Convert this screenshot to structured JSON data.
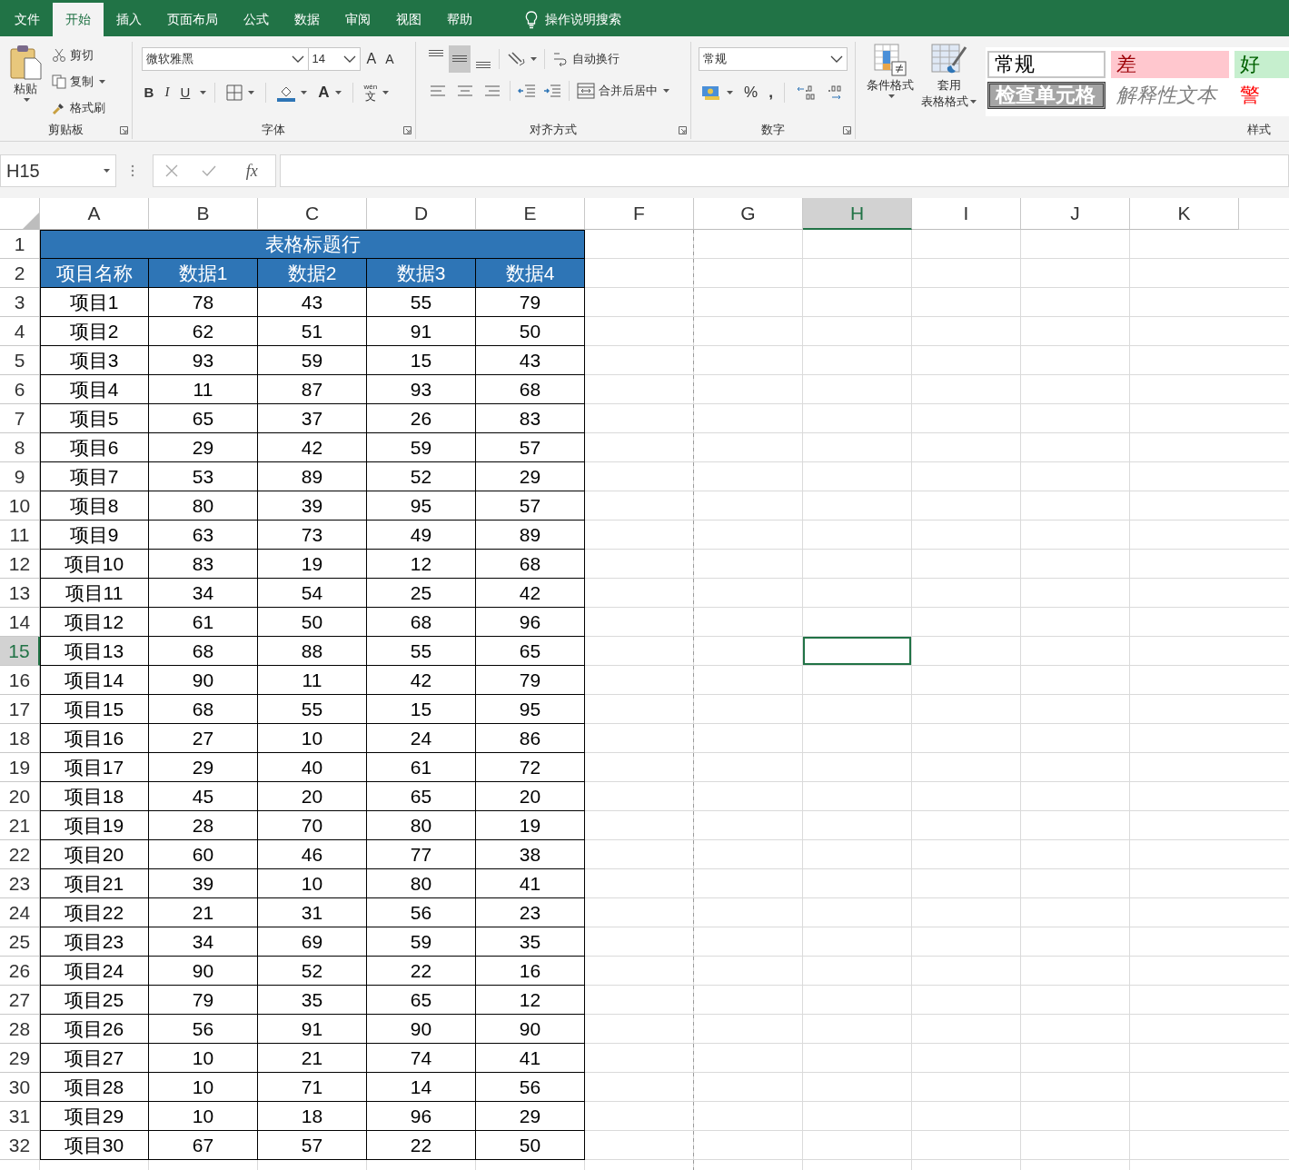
{
  "tabs": [
    {
      "label": "文件",
      "selected": false
    },
    {
      "label": "开始",
      "selected": true
    },
    {
      "label": "插入",
      "selected": false
    },
    {
      "label": "页面布局",
      "selected": false
    },
    {
      "label": "公式",
      "selected": false
    },
    {
      "label": "数据",
      "selected": false
    },
    {
      "label": "审阅",
      "selected": false
    },
    {
      "label": "视图",
      "selected": false
    },
    {
      "label": "帮助",
      "selected": false
    }
  ],
  "tell_me": {
    "placeholder": "操作说明搜索"
  },
  "ribbon": {
    "clipboard": {
      "paste": "粘贴",
      "cut": "剪切",
      "copy": "复制",
      "format_painter": "格式刷",
      "label": "剪贴板"
    },
    "font": {
      "name": "微软雅黑",
      "size": "14",
      "grow": "A",
      "shrink": "A",
      "bold": "B",
      "italic": "I",
      "underline": "U",
      "font_color": "A",
      "phonetic_top": "wén",
      "phonetic": "文",
      "label": "字体"
    },
    "alignment": {
      "vertical_align": [
        {
          "selected": false
        },
        {
          "selected": true
        },
        {
          "selected": false
        }
      ],
      "wrap_text": "自动换行",
      "merge_center": "合并后居中",
      "label": "对齐方式"
    },
    "number": {
      "format": "常规",
      "percent": "%",
      "comma": ",",
      "label": "数字"
    },
    "styles": {
      "conditional": "条件格式",
      "table_format_line1": "套用",
      "table_format_line2": "表格格式",
      "label": "样式",
      "cell_styles": [
        {
          "label": "常规",
          "kind": "normal"
        },
        {
          "label": "差",
          "kind": "bad"
        },
        {
          "label": "好",
          "kind": "good"
        },
        {
          "label": "检查单元格",
          "kind": "check"
        },
        {
          "label": "解释性文本",
          "kind": "explanatory"
        },
        {
          "label": "警",
          "kind": "warning"
        }
      ]
    }
  },
  "formula_bar": {
    "name_box": "H15",
    "fx": "fx"
  },
  "sheet": {
    "columns": [
      {
        "label": "A",
        "selected": false
      },
      {
        "label": "B",
        "selected": false
      },
      {
        "label": "C",
        "selected": false
      },
      {
        "label": "D",
        "selected": false
      },
      {
        "label": "E",
        "selected": false
      },
      {
        "label": "F",
        "selected": false
      },
      {
        "label": "G",
        "selected": false
      },
      {
        "label": "H",
        "selected": true
      },
      {
        "label": "I",
        "selected": false
      },
      {
        "label": "J",
        "selected": false
      },
      {
        "label": "K",
        "selected": false
      }
    ],
    "rows": [
      {
        "number": "1",
        "kind": "title",
        "selected": false,
        "cells": [
          "",
          "",
          "表格标题行",
          "",
          ""
        ]
      },
      {
        "number": "2",
        "kind": "header",
        "selected": false,
        "cells": [
          "项目名称",
          "数据1",
          "数据2",
          "数据3",
          "数据4"
        ]
      },
      {
        "number": "3",
        "kind": "data",
        "selected": false,
        "cells": [
          "项目1",
          "78",
          "43",
          "55",
          "79"
        ]
      },
      {
        "number": "4",
        "kind": "data",
        "selected": false,
        "cells": [
          "项目2",
          "62",
          "51",
          "91",
          "50"
        ]
      },
      {
        "number": "5",
        "kind": "data",
        "selected": false,
        "cells": [
          "项目3",
          "93",
          "59",
          "15",
          "43"
        ]
      },
      {
        "number": "6",
        "kind": "data",
        "selected": false,
        "cells": [
          "项目4",
          "11",
          "87",
          "93",
          "68"
        ]
      },
      {
        "number": "7",
        "kind": "data",
        "selected": false,
        "cells": [
          "项目5",
          "65",
          "37",
          "26",
          "83"
        ]
      },
      {
        "number": "8",
        "kind": "data",
        "selected": false,
        "cells": [
          "项目6",
          "29",
          "42",
          "59",
          "57"
        ]
      },
      {
        "number": "9",
        "kind": "data",
        "selected": false,
        "cells": [
          "项目7",
          "53",
          "89",
          "52",
          "29"
        ]
      },
      {
        "number": "10",
        "kind": "data",
        "selected": false,
        "cells": [
          "项目8",
          "80",
          "39",
          "95",
          "57"
        ]
      },
      {
        "number": "11",
        "kind": "data",
        "selected": false,
        "cells": [
          "项目9",
          "63",
          "73",
          "49",
          "89"
        ]
      },
      {
        "number": "12",
        "kind": "data",
        "selected": false,
        "cells": [
          "项目10",
          "83",
          "19",
          "12",
          "68"
        ]
      },
      {
        "number": "13",
        "kind": "data",
        "selected": false,
        "cells": [
          "项目11",
          "34",
          "54",
          "25",
          "42"
        ]
      },
      {
        "number": "14",
        "kind": "data",
        "selected": false,
        "cells": [
          "项目12",
          "61",
          "50",
          "68",
          "96"
        ]
      },
      {
        "number": "15",
        "kind": "data",
        "selected": true,
        "cells": [
          "项目13",
          "68",
          "88",
          "55",
          "65"
        ]
      },
      {
        "number": "16",
        "kind": "data",
        "selected": false,
        "cells": [
          "项目14",
          "90",
          "11",
          "42",
          "79"
        ]
      },
      {
        "number": "17",
        "kind": "data",
        "selected": false,
        "cells": [
          "项目15",
          "68",
          "55",
          "15",
          "95"
        ]
      },
      {
        "number": "18",
        "kind": "data",
        "selected": false,
        "cells": [
          "项目16",
          "27",
          "10",
          "24",
          "86"
        ]
      },
      {
        "number": "19",
        "kind": "data",
        "selected": false,
        "cells": [
          "项目17",
          "29",
          "40",
          "61",
          "72"
        ]
      },
      {
        "number": "20",
        "kind": "data",
        "selected": false,
        "cells": [
          "项目18",
          "45",
          "20",
          "65",
          "20"
        ]
      },
      {
        "number": "21",
        "kind": "data",
        "selected": false,
        "cells": [
          "项目19",
          "28",
          "70",
          "80",
          "19"
        ]
      },
      {
        "number": "22",
        "kind": "data",
        "selected": false,
        "cells": [
          "项目20",
          "60",
          "46",
          "77",
          "38"
        ]
      },
      {
        "number": "23",
        "kind": "data",
        "selected": false,
        "cells": [
          "项目21",
          "39",
          "10",
          "80",
          "41"
        ]
      },
      {
        "number": "24",
        "kind": "data",
        "selected": false,
        "cells": [
          "项目22",
          "21",
          "31",
          "56",
          "23"
        ]
      },
      {
        "number": "25",
        "kind": "data",
        "selected": false,
        "cells": [
          "项目23",
          "34",
          "69",
          "59",
          "35"
        ]
      },
      {
        "number": "26",
        "kind": "data",
        "selected": false,
        "cells": [
          "项目24",
          "90",
          "52",
          "22",
          "16"
        ]
      },
      {
        "number": "27",
        "kind": "data",
        "selected": false,
        "cells": [
          "项目25",
          "79",
          "35",
          "65",
          "12"
        ]
      },
      {
        "number": "28",
        "kind": "data",
        "selected": false,
        "cells": [
          "项目26",
          "56",
          "91",
          "90",
          "90"
        ]
      },
      {
        "number": "29",
        "kind": "data",
        "selected": false,
        "cells": [
          "项目27",
          "10",
          "21",
          "74",
          "41"
        ]
      },
      {
        "number": "30",
        "kind": "data",
        "selected": false,
        "cells": [
          "项目28",
          "10",
          "71",
          "14",
          "56"
        ]
      },
      {
        "number": "31",
        "kind": "data",
        "selected": false,
        "cells": [
          "项目29",
          "10",
          "18",
          "96",
          "29"
        ]
      },
      {
        "number": "32",
        "kind": "data",
        "selected": false,
        "cells": [
          "项目30",
          "67",
          "57",
          "22",
          "50"
        ]
      }
    ]
  }
}
